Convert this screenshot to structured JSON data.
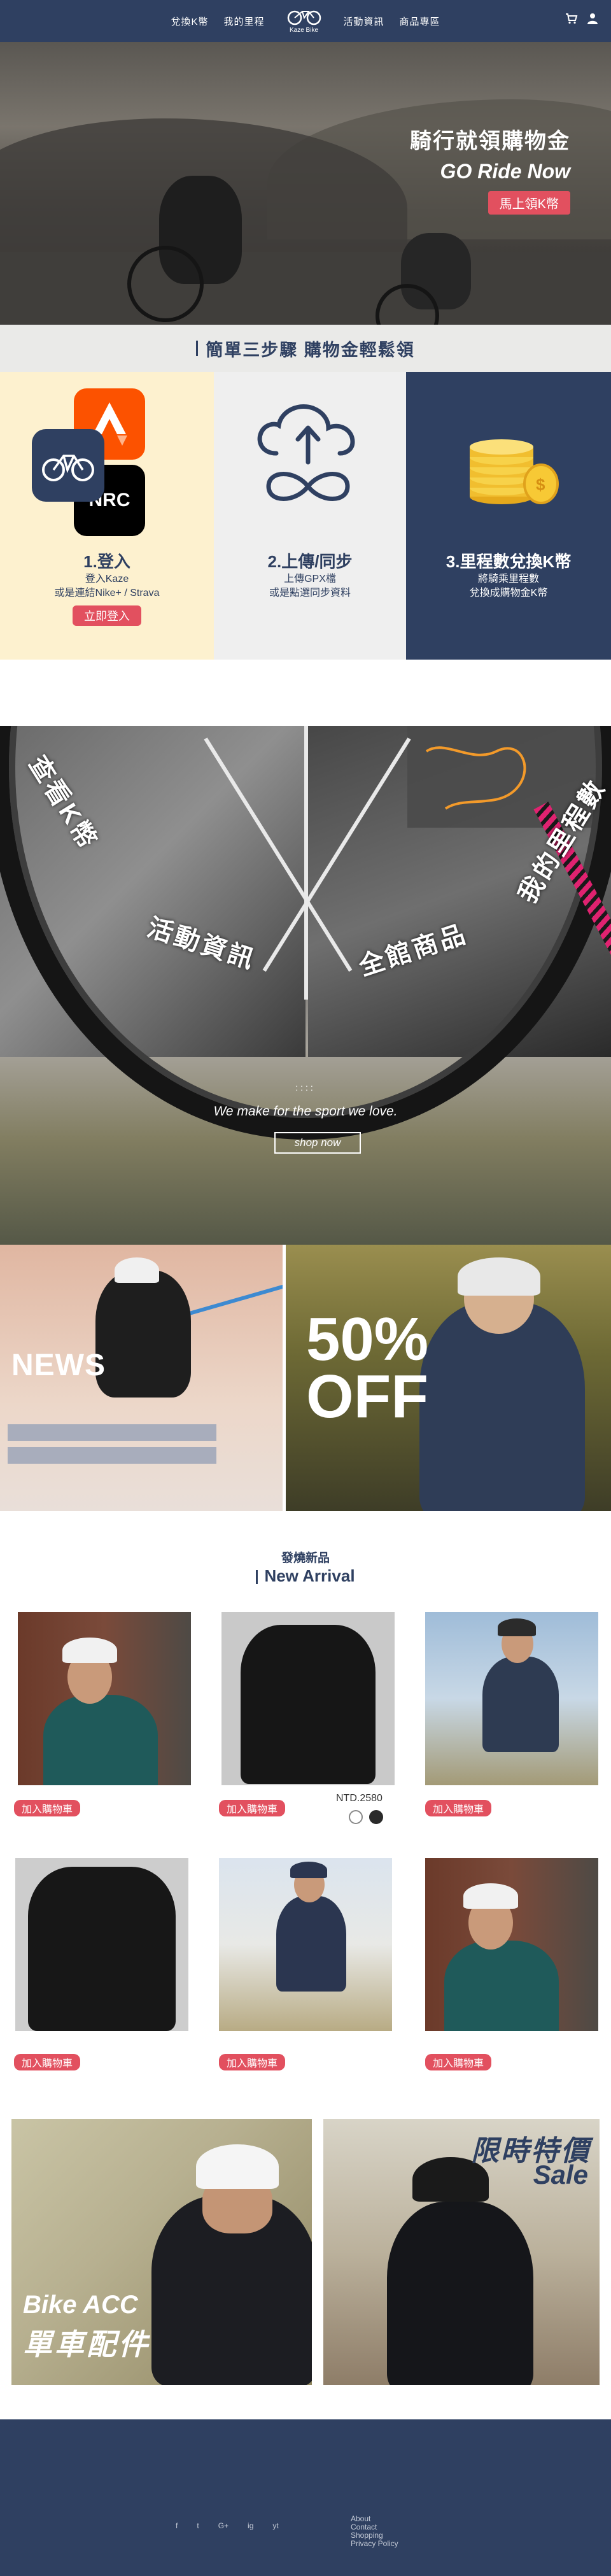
{
  "nav": {
    "items": [
      "兌換K幣",
      "我的里程",
      "活動資訊",
      "商品專區"
    ],
    "logo_text": "Kaze Bike",
    "icons": [
      "cart-icon",
      "user-icon"
    ]
  },
  "hero": {
    "line1": "騎行就領購物金",
    "line2": "GO Ride Now",
    "button": "馬上領K幣"
  },
  "steps": {
    "title": "簡單三步驟  購物金輕鬆領",
    "items": [
      {
        "title": "1.登入",
        "line1": "登入Kaze",
        "line2": "或是連結Nike+ / Strava",
        "button": "立即登入",
        "badge": "NRC"
      },
      {
        "title": "2.上傳/同步",
        "line1": "上傳GPX檔",
        "line2": "或是點選同步資料"
      },
      {
        "title": "3.里程數兌換K幣",
        "line1": "將騎乘里程數",
        "line2": "兌換成購物金K幣"
      }
    ]
  },
  "wheel": {
    "labels": [
      "查看K幣",
      "活動資訊",
      "全館商品",
      "我的里程數"
    ],
    "dots": "::::",
    "slogan": "We make for the sport we love.",
    "button": "shop  now"
  },
  "banners": {
    "news": "NEWS",
    "sale_line1": "50%",
    "sale_line2": "OFF"
  },
  "new_arrival": {
    "subtitle": "發燒新品",
    "title": "New Arrival",
    "cart_label": "加入購物車",
    "price": "NTD.2580",
    "swatches": [
      "#ffffff",
      "#2a2a2a"
    ]
  },
  "bottom": {
    "acc_line1": "Bike ACC",
    "acc_line2": "單車配件",
    "ltd_line1": "限時特價",
    "ltd_line2": "Sale"
  },
  "footer": {
    "social": [
      "f",
      "t",
      "G+",
      "ig",
      "yt"
    ],
    "links": [
      "About",
      "Contact",
      "Shopping",
      "Privacy Policy"
    ]
  },
  "colors": {
    "primary": "#2f4061",
    "accent": "#e2505f",
    "cream": "#fdf1cf"
  }
}
